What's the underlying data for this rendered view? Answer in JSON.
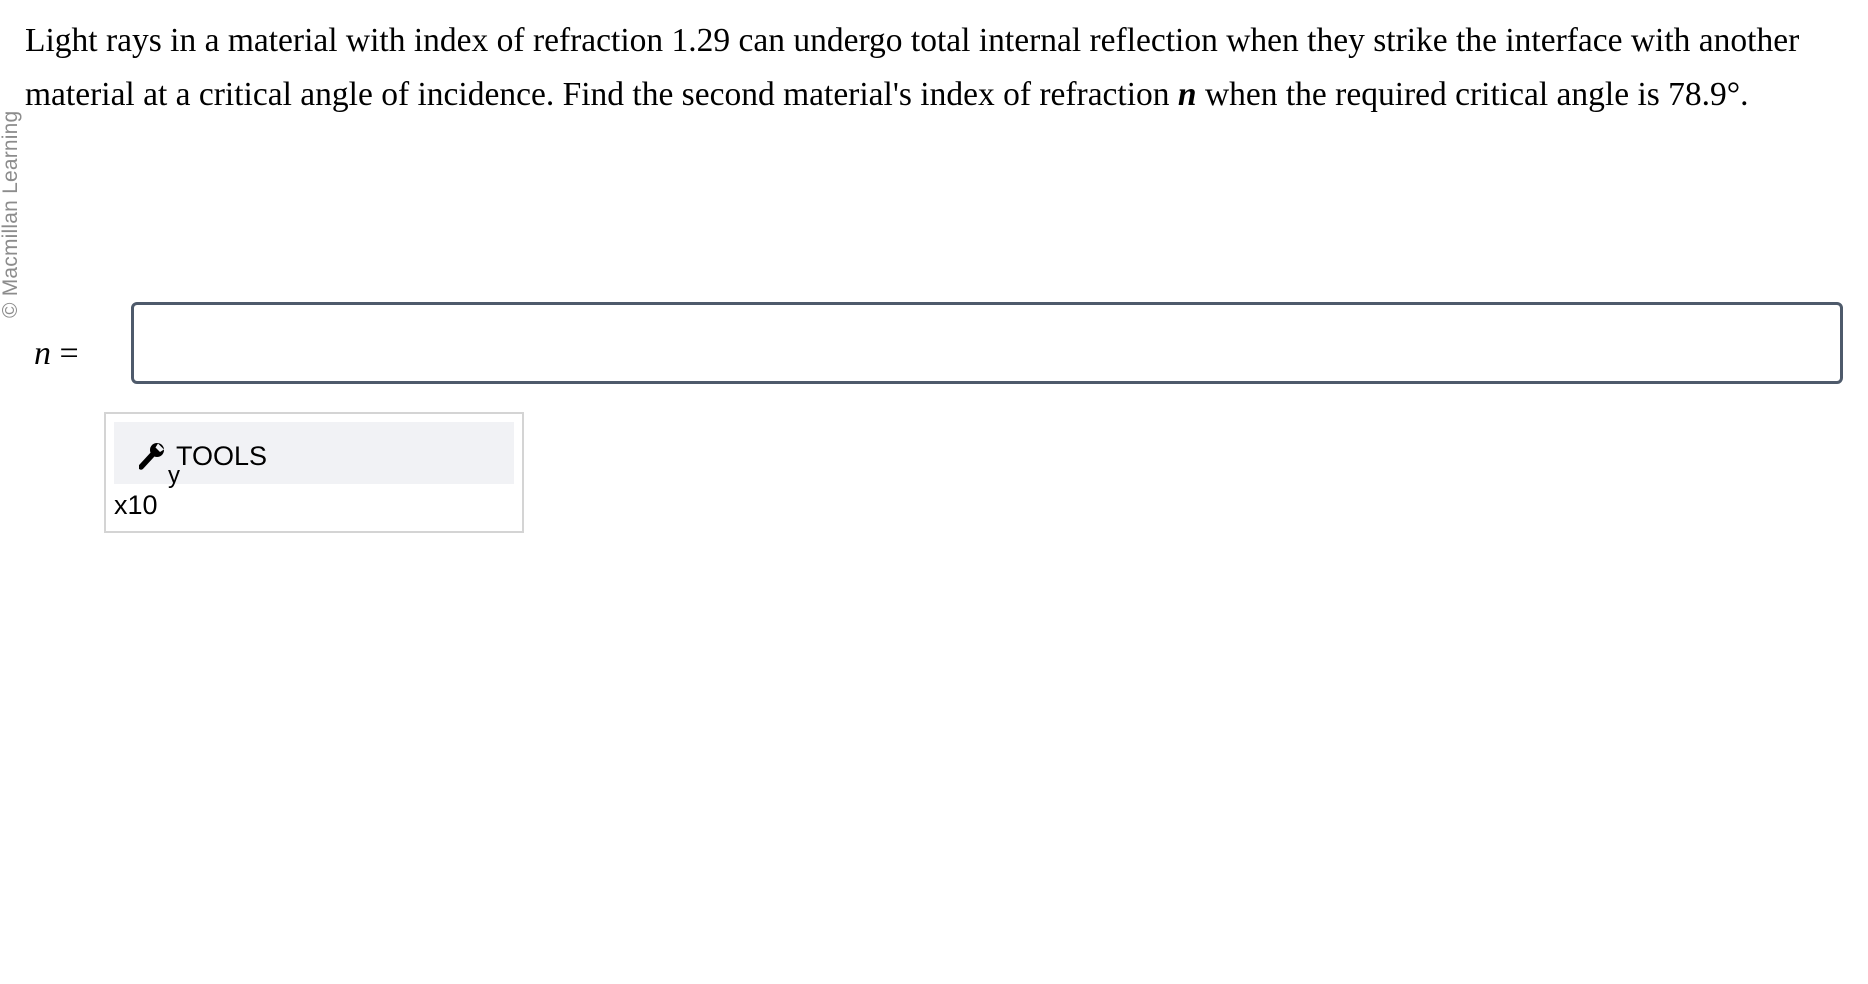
{
  "watermark": "© Macmillan Learning",
  "question": {
    "text_before": "Light rays in a material with index of refraction 1.29 can undergo total internal reflection when they strike the interface with another material at a critical angle of incidence. Find the second material's index of refraction ",
    "variable": "n",
    "text_after": " when the required critical angle is 78.9°."
  },
  "answer": {
    "variable": "n",
    "equals": " =",
    "value": "",
    "placeholder": ""
  },
  "tools": {
    "label": "TOOLS",
    "sub_label": "y",
    "icon": "wrench-icon",
    "multiplier_label": "x10"
  }
}
